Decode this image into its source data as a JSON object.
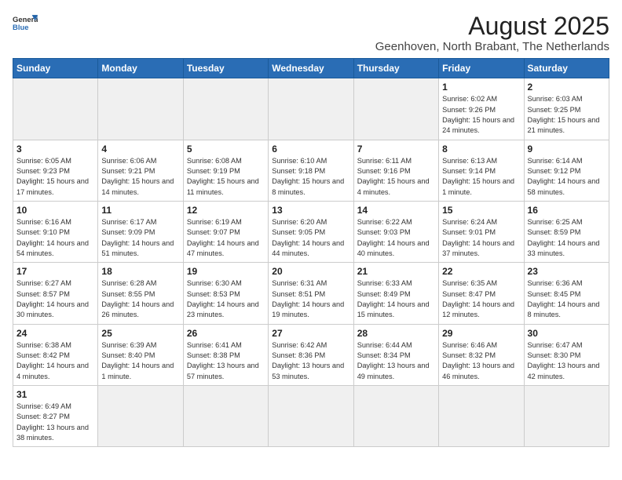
{
  "header": {
    "logo_line1": "General",
    "logo_line2": "Blue",
    "month_year": "August 2025",
    "location": "Geenhoven, North Brabant, The Netherlands"
  },
  "days_of_week": [
    "Sunday",
    "Monday",
    "Tuesday",
    "Wednesday",
    "Thursday",
    "Friday",
    "Saturday"
  ],
  "weeks": [
    [
      {
        "day": "",
        "empty": true
      },
      {
        "day": "",
        "empty": true
      },
      {
        "day": "",
        "empty": true
      },
      {
        "day": "",
        "empty": true
      },
      {
        "day": "",
        "empty": true
      },
      {
        "day": "1",
        "sunrise": "6:02 AM",
        "sunset": "9:26 PM",
        "daylight": "15 hours and 24 minutes."
      },
      {
        "day": "2",
        "sunrise": "6:03 AM",
        "sunset": "9:25 PM",
        "daylight": "15 hours and 21 minutes."
      }
    ],
    [
      {
        "day": "3",
        "sunrise": "6:05 AM",
        "sunset": "9:23 PM",
        "daylight": "15 hours and 17 minutes."
      },
      {
        "day": "4",
        "sunrise": "6:06 AM",
        "sunset": "9:21 PM",
        "daylight": "15 hours and 14 minutes."
      },
      {
        "day": "5",
        "sunrise": "6:08 AM",
        "sunset": "9:19 PM",
        "daylight": "15 hours and 11 minutes."
      },
      {
        "day": "6",
        "sunrise": "6:10 AM",
        "sunset": "9:18 PM",
        "daylight": "15 hours and 8 minutes."
      },
      {
        "day": "7",
        "sunrise": "6:11 AM",
        "sunset": "9:16 PM",
        "daylight": "15 hours and 4 minutes."
      },
      {
        "day": "8",
        "sunrise": "6:13 AM",
        "sunset": "9:14 PM",
        "daylight": "15 hours and 1 minute."
      },
      {
        "day": "9",
        "sunrise": "6:14 AM",
        "sunset": "9:12 PM",
        "daylight": "14 hours and 58 minutes."
      }
    ],
    [
      {
        "day": "10",
        "sunrise": "6:16 AM",
        "sunset": "9:10 PM",
        "daylight": "14 hours and 54 minutes."
      },
      {
        "day": "11",
        "sunrise": "6:17 AM",
        "sunset": "9:09 PM",
        "daylight": "14 hours and 51 minutes."
      },
      {
        "day": "12",
        "sunrise": "6:19 AM",
        "sunset": "9:07 PM",
        "daylight": "14 hours and 47 minutes."
      },
      {
        "day": "13",
        "sunrise": "6:20 AM",
        "sunset": "9:05 PM",
        "daylight": "14 hours and 44 minutes."
      },
      {
        "day": "14",
        "sunrise": "6:22 AM",
        "sunset": "9:03 PM",
        "daylight": "14 hours and 40 minutes."
      },
      {
        "day": "15",
        "sunrise": "6:24 AM",
        "sunset": "9:01 PM",
        "daylight": "14 hours and 37 minutes."
      },
      {
        "day": "16",
        "sunrise": "6:25 AM",
        "sunset": "8:59 PM",
        "daylight": "14 hours and 33 minutes."
      }
    ],
    [
      {
        "day": "17",
        "sunrise": "6:27 AM",
        "sunset": "8:57 PM",
        "daylight": "14 hours and 30 minutes."
      },
      {
        "day": "18",
        "sunrise": "6:28 AM",
        "sunset": "8:55 PM",
        "daylight": "14 hours and 26 minutes."
      },
      {
        "day": "19",
        "sunrise": "6:30 AM",
        "sunset": "8:53 PM",
        "daylight": "14 hours and 23 minutes."
      },
      {
        "day": "20",
        "sunrise": "6:31 AM",
        "sunset": "8:51 PM",
        "daylight": "14 hours and 19 minutes."
      },
      {
        "day": "21",
        "sunrise": "6:33 AM",
        "sunset": "8:49 PM",
        "daylight": "14 hours and 15 minutes."
      },
      {
        "day": "22",
        "sunrise": "6:35 AM",
        "sunset": "8:47 PM",
        "daylight": "14 hours and 12 minutes."
      },
      {
        "day": "23",
        "sunrise": "6:36 AM",
        "sunset": "8:45 PM",
        "daylight": "14 hours and 8 minutes."
      }
    ],
    [
      {
        "day": "24",
        "sunrise": "6:38 AM",
        "sunset": "8:42 PM",
        "daylight": "14 hours and 4 minutes."
      },
      {
        "day": "25",
        "sunrise": "6:39 AM",
        "sunset": "8:40 PM",
        "daylight": "14 hours and 1 minute."
      },
      {
        "day": "26",
        "sunrise": "6:41 AM",
        "sunset": "8:38 PM",
        "daylight": "13 hours and 57 minutes."
      },
      {
        "day": "27",
        "sunrise": "6:42 AM",
        "sunset": "8:36 PM",
        "daylight": "13 hours and 53 minutes."
      },
      {
        "day": "28",
        "sunrise": "6:44 AM",
        "sunset": "8:34 PM",
        "daylight": "13 hours and 49 minutes."
      },
      {
        "day": "29",
        "sunrise": "6:46 AM",
        "sunset": "8:32 PM",
        "daylight": "13 hours and 46 minutes."
      },
      {
        "day": "30",
        "sunrise": "6:47 AM",
        "sunset": "8:30 PM",
        "daylight": "13 hours and 42 minutes."
      }
    ],
    [
      {
        "day": "31",
        "sunrise": "6:49 AM",
        "sunset": "8:27 PM",
        "daylight": "13 hours and 38 minutes."
      },
      {
        "day": "",
        "empty": true
      },
      {
        "day": "",
        "empty": true
      },
      {
        "day": "",
        "empty": true
      },
      {
        "day": "",
        "empty": true
      },
      {
        "day": "",
        "empty": true
      },
      {
        "day": "",
        "empty": true
      }
    ]
  ]
}
